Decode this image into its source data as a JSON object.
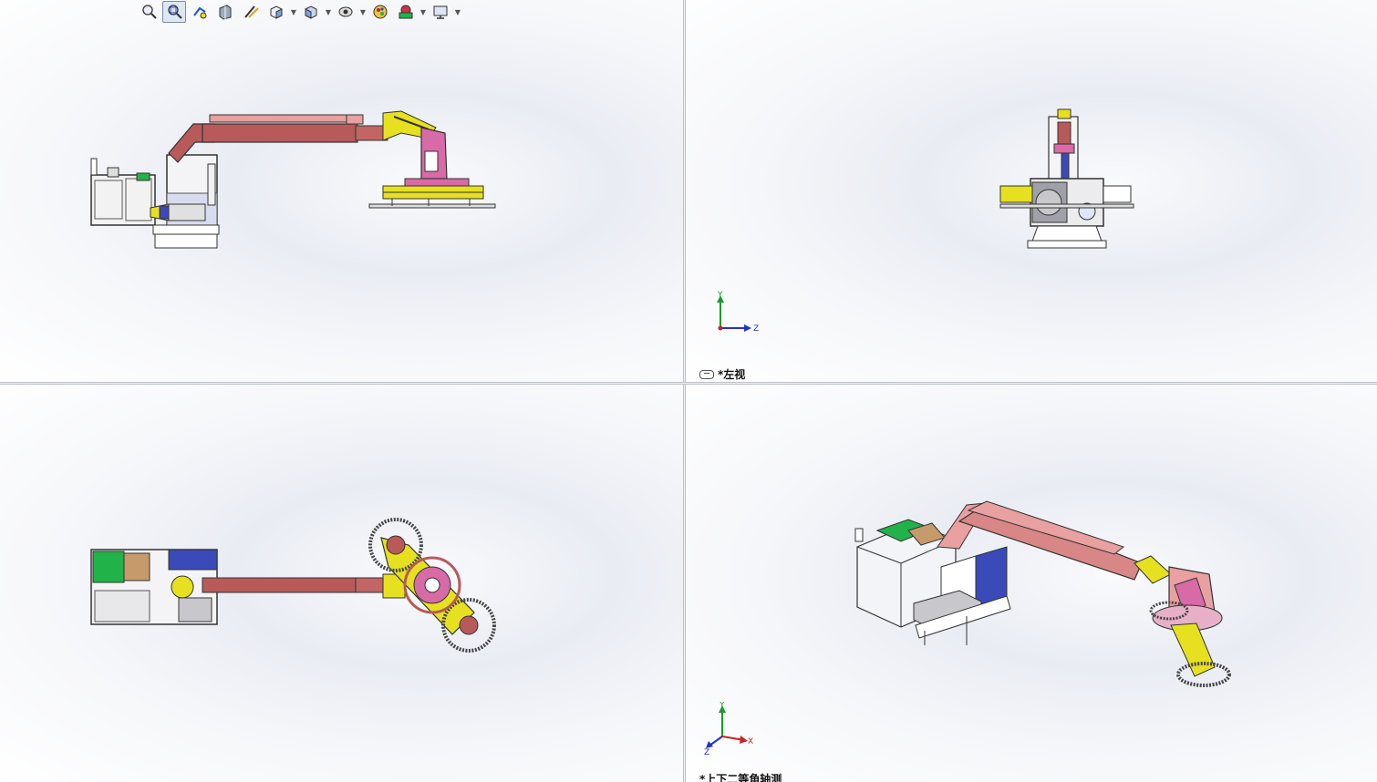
{
  "toolbar": {
    "items": [
      {
        "name": "zoom-to-fit-icon"
      },
      {
        "name": "zoom-to-area-icon",
        "active": true
      },
      {
        "name": "previous-view-icon"
      },
      {
        "name": "section-view-icon"
      },
      {
        "name": "dynamic-annotation-icon"
      },
      {
        "name": "view-orientation-icon",
        "dropdown": true
      },
      {
        "name": "display-style-icon",
        "dropdown": true
      },
      {
        "name": "hide-show-items-icon",
        "dropdown": true
      },
      {
        "name": "edit-appearance-icon"
      },
      {
        "name": "apply-scene-icon",
        "dropdown": true
      },
      {
        "name": "view-settings-icon",
        "dropdown": true
      }
    ]
  },
  "viewports": {
    "top_right": {
      "label": "*左视",
      "triad": {
        "up": "Y",
        "right": "Z"
      }
    },
    "bottom_right": {
      "label": "*上下二等角轴测",
      "triad": {
        "up": "Y",
        "right": "X",
        "left": "Z"
      }
    }
  },
  "colors": {
    "arm": "#b85a5a",
    "arm_light": "#e8a0a0",
    "yellow": "#e6e020",
    "pink": "#d86aa8",
    "green": "#22b24a",
    "blue": "#3a4ab8",
    "outline": "#3a3a3a",
    "triad_y": "#1a9a2a",
    "triad_z": "#2233cc",
    "triad_x": "#cc2222"
  }
}
